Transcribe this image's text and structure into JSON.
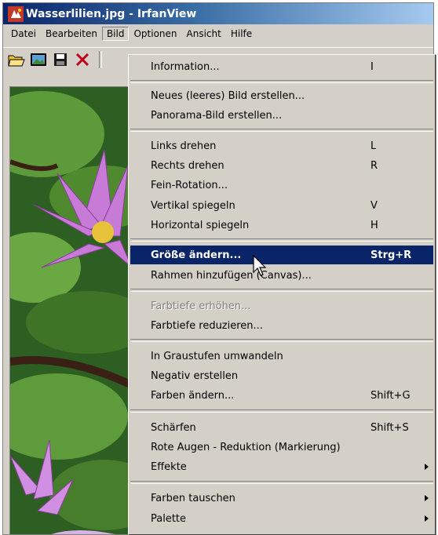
{
  "window": {
    "title": "Wasserlilien.jpg - IrfanView"
  },
  "menubar": {
    "items": [
      "Datei",
      "Bearbeiten",
      "Bild",
      "Optionen",
      "Ansicht",
      "Hilfe"
    ],
    "active": "Bild"
  },
  "toolbar": {
    "icons": [
      "open-folder-icon",
      "slideshow-icon",
      "save-icon",
      "delete-icon"
    ]
  },
  "bild_menu": {
    "items": [
      {
        "label": "Information...",
        "shortcut": "I"
      },
      {
        "label": "Neues (leeres) Bild erstellen...",
        "shortcut": ""
      },
      {
        "label": "Panorama-Bild erstellen...",
        "shortcut": ""
      },
      {
        "label": "Links drehen",
        "shortcut": "L"
      },
      {
        "label": "Rechts drehen",
        "shortcut": "R"
      },
      {
        "label": "Fein-Rotation...",
        "shortcut": ""
      },
      {
        "label": "Vertikal spiegeln",
        "shortcut": "V"
      },
      {
        "label": "Horizontal spiegeln",
        "shortcut": "H"
      },
      {
        "label": "Größe ändern...",
        "shortcut": "Strg+R",
        "highlighted": true
      },
      {
        "label": "Rahmen hinzufügen (Canvas)...",
        "shortcut": ""
      },
      {
        "label": "Farbtiefe erhöhen...",
        "shortcut": "",
        "disabled": true
      },
      {
        "label": "Farbtiefe reduzieren...",
        "shortcut": ""
      },
      {
        "label": "In Graustufen umwandeln",
        "shortcut": ""
      },
      {
        "label": "Negativ erstellen",
        "shortcut": ""
      },
      {
        "label": "Farben ändern...",
        "shortcut": "Shift+G"
      },
      {
        "label": "Schärfen",
        "shortcut": "Shift+S"
      },
      {
        "label": "Rote Augen - Reduktion (Markierung)",
        "shortcut": ""
      },
      {
        "label": "Effekte",
        "shortcut": "",
        "submenu": true
      },
      {
        "label": "Farben tauschen",
        "shortcut": "",
        "submenu": true
      },
      {
        "label": "Palette",
        "shortcut": "",
        "submenu": true
      }
    ]
  },
  "colors": {
    "menu_bg": "#d4d0c8",
    "highlight": "#0a246a",
    "title_start": "#0a246a",
    "title_end": "#a6caf0"
  }
}
